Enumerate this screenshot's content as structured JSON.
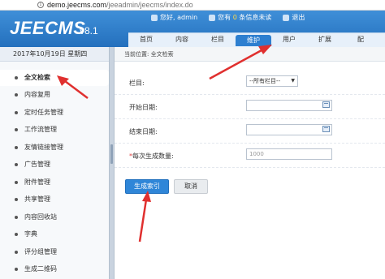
{
  "browser": {
    "url_host": "demo.jeecms.com",
    "url_path": "/jeeadmin/jeecms/index.do"
  },
  "header": {
    "logo": "JEECMS",
    "version": "v8.1",
    "greeting": "您好, admin",
    "messages_prefix": "您有",
    "messages_count": "0",
    "messages_suffix": "条信息未读",
    "logout": "退出"
  },
  "nav": [
    {
      "label": "首页",
      "active": false
    },
    {
      "label": "内容",
      "active": false
    },
    {
      "label": "栏目",
      "active": false
    },
    {
      "label": "维护",
      "active": true
    },
    {
      "label": "用户",
      "active": false
    },
    {
      "label": "扩展",
      "active": false
    },
    {
      "label": "配",
      "active": false
    }
  ],
  "date": "2017年10月19日 星期四",
  "breadcrumb": "当前位置: 全文检索",
  "sidebar": [
    {
      "label": "全文检索",
      "active": true
    },
    {
      "label": "内容复用",
      "active": false
    },
    {
      "label": "定时任务管理",
      "active": false
    },
    {
      "label": "工作流管理",
      "active": false
    },
    {
      "label": "友情链接管理",
      "active": false
    },
    {
      "label": "广告管理",
      "active": false
    },
    {
      "label": "附件管理",
      "active": false
    },
    {
      "label": "共享管理",
      "active": false
    },
    {
      "label": "内容回收站",
      "active": false
    },
    {
      "label": "字典",
      "active": false
    },
    {
      "label": "评分组管理",
      "active": false
    },
    {
      "label": "生成二维码",
      "active": false
    }
  ],
  "form": {
    "column_label": "栏目:",
    "column_value": "--所有栏目--",
    "start_date_label": "开始日期:",
    "start_date_value": "",
    "end_date_label": "结束日期:",
    "end_date_value": "",
    "count_required_mark": "*",
    "count_label": "每次生成数量:",
    "count_value": "1000"
  },
  "buttons": {
    "generate": "生成索引",
    "cancel": "取消"
  },
  "colors": {
    "header_blue": "#2d7fd0",
    "annotation_red": "#e0302f"
  }
}
